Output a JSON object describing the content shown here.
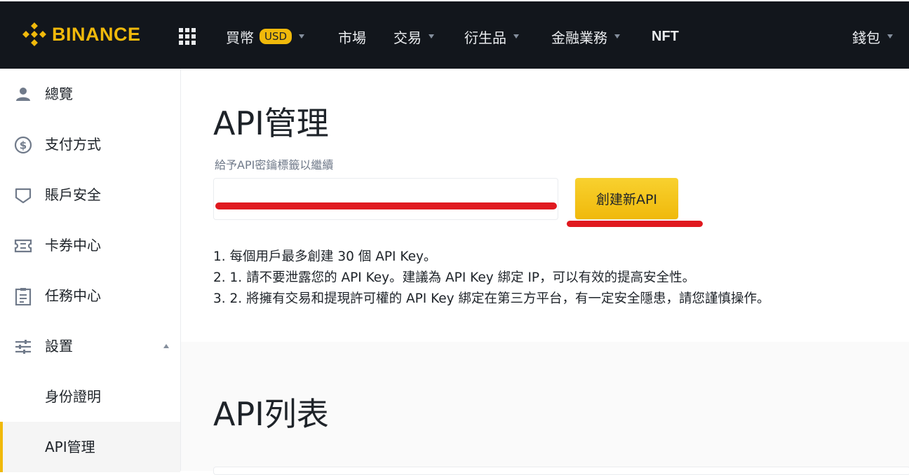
{
  "header": {
    "brand": "BINANCE",
    "nav": [
      {
        "label": "買幣",
        "badge": "USD",
        "has_dropdown": true
      },
      {
        "label": "市場",
        "has_dropdown": false
      },
      {
        "label": "交易",
        "has_dropdown": true
      },
      {
        "label": "衍生品",
        "has_dropdown": true
      },
      {
        "label": "金融業務",
        "has_dropdown": true
      },
      {
        "label": "NFT",
        "has_dropdown": false
      }
    ],
    "wallet": {
      "label": "錢包",
      "has_dropdown": true
    }
  },
  "sidebar": {
    "items": [
      {
        "label": "總覽",
        "icon": "user-icon"
      },
      {
        "label": "支付方式",
        "icon": "dollar-circle-icon"
      },
      {
        "label": "賬戶安全",
        "icon": "shield-icon"
      },
      {
        "label": "卡券中心",
        "icon": "ticket-icon"
      },
      {
        "label": "任務中心",
        "icon": "clipboard-icon"
      },
      {
        "label": "設置",
        "icon": "sliders-icon",
        "expanded": true
      },
      {
        "label": "身份證明"
      },
      {
        "label": "API管理",
        "active": true
      }
    ]
  },
  "main": {
    "title": "API管理",
    "input_label": "給予API密鑰標籤以繼續",
    "input_value": "",
    "create_button": "創建新API",
    "notes": [
      "1. 每個用戶最多創建 30 個 API Key。",
      "2. 1. 請不要泄露您的 API Key。建議為 API Key 綁定 IP，可以有效的提高安全性。",
      "3. 2. 將擁有交易和提現許可權的 API Key 綁定在第三方平台，有一定安全隱患，請您謹慎操作。"
    ],
    "list_title": "API列表"
  },
  "colors": {
    "brand_yellow": "#f0b90b",
    "header_bg": "#12161c",
    "annotation_red": "#e0191f"
  }
}
